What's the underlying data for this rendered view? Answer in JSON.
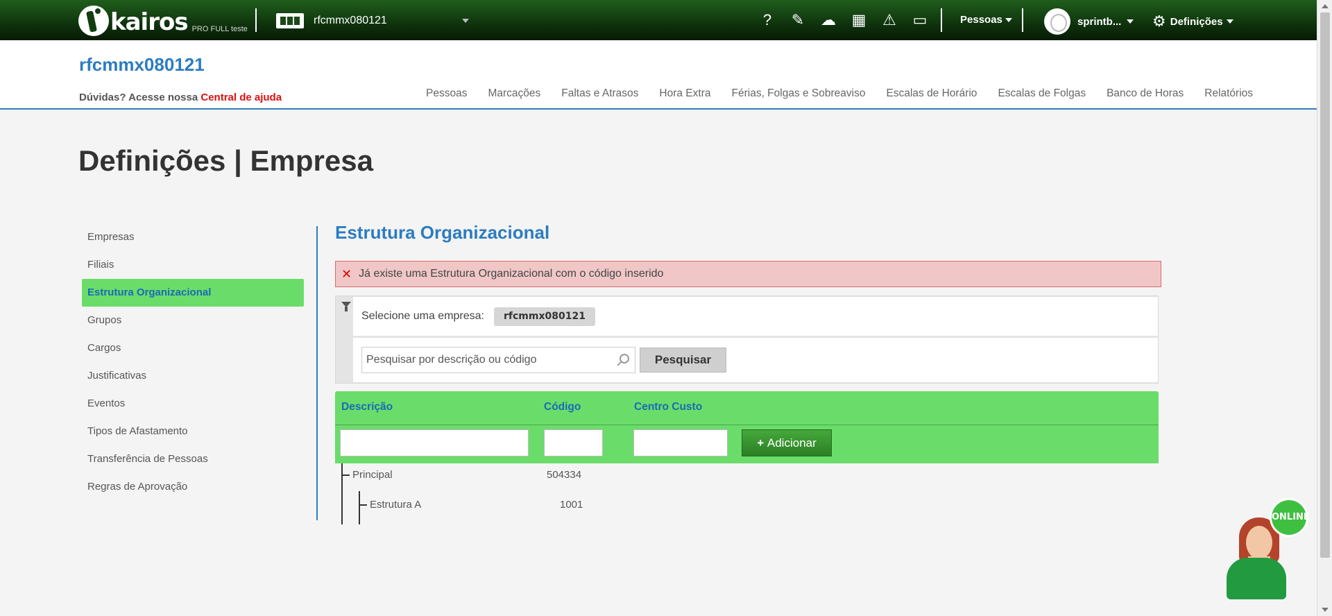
{
  "topbar": {
    "logo_text": "kairos",
    "logo_sub": "PRO FULL teste",
    "company": "rfcmmx080121",
    "tools": [
      {
        "icon": "help-icon",
        "glyph": "?"
      },
      {
        "icon": "plug-icon",
        "glyph": "✎"
      },
      {
        "icon": "cloud-download-icon",
        "glyph": "☁"
      },
      {
        "icon": "calculator-icon",
        "glyph": "▦"
      },
      {
        "icon": "warning-icon",
        "glyph": "⚠"
      },
      {
        "icon": "inbox-icon",
        "glyph": "▭"
      }
    ],
    "pessoas_menu": "Pessoas",
    "user": "sprintb...",
    "settings": "Definições"
  },
  "header": {
    "title": "rfcmmx080121",
    "help_prefix": "Dúvidas? Acesse nossa ",
    "help_link": "Central de ajuda",
    "nav": [
      "Pessoas",
      "Marcações",
      "Faltas e Atrasos",
      "Hora Extra",
      "Férias, Folgas e Sobreaviso",
      "Escalas de Horário",
      "Escalas de Folgas",
      "Banco de Horas",
      "Relatórios"
    ]
  },
  "page": {
    "title": "Definições | Empresa"
  },
  "sidenav": {
    "items": [
      "Empresas",
      "Filiais",
      "Estrutura Organizacional",
      "Grupos",
      "Cargos",
      "Justificativas",
      "Eventos",
      "Tipos de Afastamento",
      "Transferência de Pessoas",
      "Regras de Aprovação"
    ],
    "active": "Estrutura Organizacional"
  },
  "content": {
    "title": "Estrutura Organizacional",
    "alert": "Já existe uma Estrutura Organizacional com o código inserido",
    "filter": {
      "company_label": "Selecione uma empresa:",
      "company_value": "rfcmmx080121",
      "search_placeholder": "Pesquisar por descrição ou código",
      "search_button": "Pesquisar"
    },
    "grid": {
      "columns": [
        "Descrição",
        "Código",
        "Centro Custo"
      ],
      "add_button": "Adicionar",
      "rows": [
        {
          "description": "Principal",
          "code": "504334"
        },
        {
          "description": "Estrutura A",
          "code": "1001"
        }
      ]
    }
  },
  "widget": {
    "status": "ONLINE"
  },
  "colors": {
    "topbar": "#0f330d",
    "accent_blue": "#2c7cc0",
    "active_green": "#6adc6a",
    "alert_bg": "#f0c6c6",
    "help_link": "#e10e0e"
  }
}
